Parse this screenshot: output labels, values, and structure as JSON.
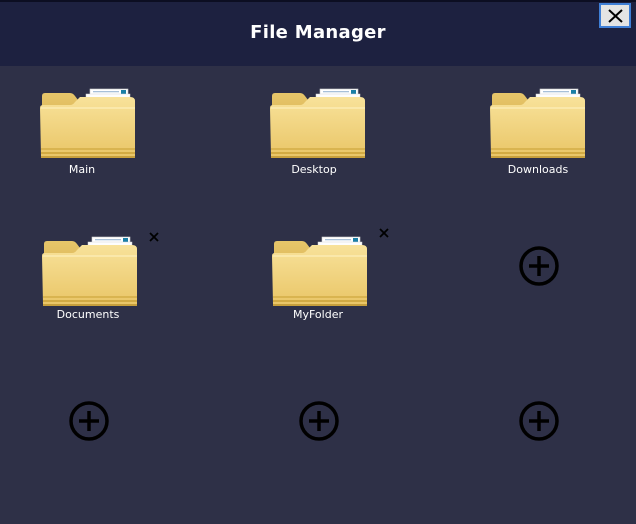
{
  "window": {
    "title": "File Manager"
  },
  "icons": {
    "close": "close-icon",
    "folder": "folder-icon",
    "delete": "delete-icon",
    "add": "add-circle-icon"
  },
  "colors": {
    "background": "#2e3047",
    "titlebar": "#1d2140",
    "folder_body": "#f0d37c",
    "folder_back": "#dcb552",
    "add_icon": "#000000"
  },
  "folders": [
    {
      "label": "Main",
      "deletable": false
    },
    {
      "label": "Desktop",
      "deletable": false
    },
    {
      "label": "Downloads",
      "deletable": false
    },
    {
      "label": "Documents",
      "deletable": true
    },
    {
      "label": "MyFolder",
      "deletable": true
    }
  ],
  "empty_slots": 4
}
